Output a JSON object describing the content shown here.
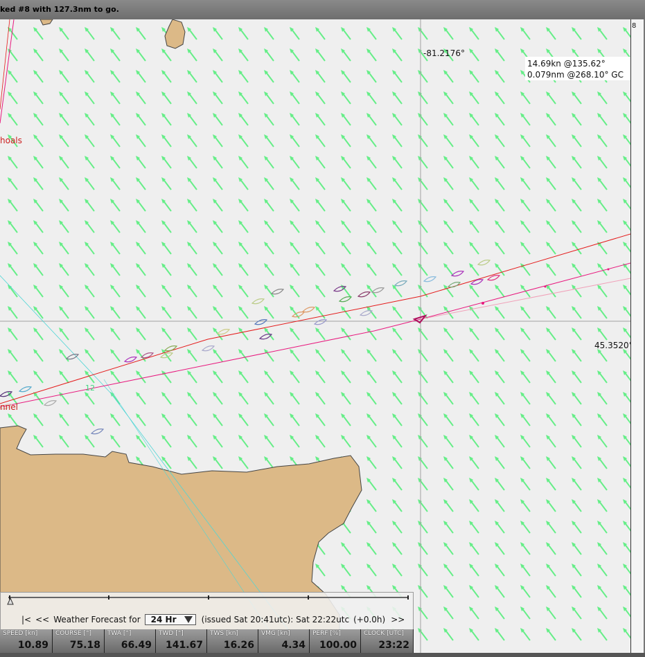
{
  "title": {
    "text": "ked #8 with 127.3nm to go."
  },
  "map": {
    "longitude_label": "-81.2176°",
    "latitude_label": "45.3520°",
    "edge_label": "8",
    "readout": {
      "line1": "14.69kn @135.62°",
      "line2": "0.079nm @268.10° GC"
    },
    "places": {
      "shoals": "hoals",
      "channel": "nnel"
    },
    "marker": "12",
    "colors": {
      "sea": "#efefef",
      "land": "#dcb987",
      "wind_arrow": "#66ee88",
      "route": "#e8197e",
      "rhumb": "#e41a1a"
    }
  },
  "forecast": {
    "nav_first": "|<",
    "nav_prev": "<<",
    "label": "Weather Forecast for",
    "selected": "24 Hr",
    "issued": "(issued Sat 20:41utc): Sat 22:22utc",
    "offset": "(+0.0h)",
    "nav_next": ">>"
  },
  "stats": [
    {
      "label": "SPEED [kn]",
      "value": "10.89"
    },
    {
      "label": "COURSE [°]",
      "value": "75.18"
    },
    {
      "label": "TWA [°]",
      "value": "66.49"
    },
    {
      "label": "TWD [°]",
      "value": "141.67"
    },
    {
      "label": "TWS [kn]",
      "value": "16.26"
    },
    {
      "label": "VMG [kn]",
      "value": "4.34"
    },
    {
      "label": "PERF [%]",
      "value": "100.00"
    },
    {
      "label": "CLOCK [UTC]",
      "value": "23:22"
    }
  ]
}
